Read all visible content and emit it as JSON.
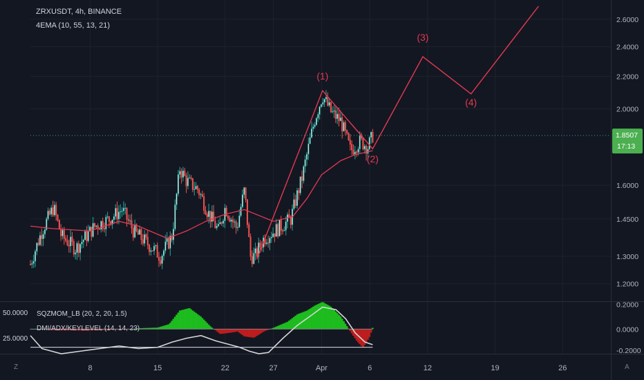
{
  "header": {
    "symbol_line": "ZRXUSDT, 4h, BINANCE",
    "indicator_line": "4EMA (10, 55, 13, 21)"
  },
  "sub_pane": {
    "indicator_1": "SQZMOM_LB (20, 2, 20, 1.5)",
    "indicator_2": "DMI/ADX/KEYLEVEL (14, 14, 23)",
    "left_scale": [
      "50.0000",
      "25.0000"
    ]
  },
  "price_badge": {
    "price": "1.8507",
    "countdown": "17:13"
  },
  "corners": {
    "left": "Z",
    "right": "A"
  },
  "colors": {
    "up": "#26a69a",
    "down": "#ef5350",
    "ema": "#e53950",
    "wave": "#e53950",
    "osc_green": "#1ec81e",
    "osc_red": "#c81e1e",
    "dmi": "#d6d6d6",
    "badge": "#4caf50"
  },
  "chart_data": [
    {
      "type": "candlestick",
      "title": "ZRXUSDT, 4h, BINANCE",
      "y_scale": "log",
      "ylim": [
        1.14,
        2.75
      ],
      "y_ticks": [
        "2.6000",
        "2.4000",
        "2.2000",
        "2.0000",
        "1.6000",
        "1.4500",
        "1.3000",
        "1.2000"
      ],
      "y_tick_values": [
        2.6,
        2.4,
        2.2,
        2.0,
        1.6,
        1.45,
        1.3,
        1.2
      ],
      "x_ticks": [
        "8",
        "15",
        "22",
        "27",
        "Apr",
        "6",
        "12",
        "19",
        "26"
      ],
      "x_tick_days": [
        8,
        15,
        22,
        27,
        32,
        37,
        43,
        50,
        57
      ],
      "x_range_days": [
        1.8,
        62.0
      ],
      "last_day": 37.3,
      "current_price": 1.8507,
      "price_path": [
        [
          1.8,
          1.27
        ],
        [
          3.0,
          1.4
        ],
        [
          4.2,
          1.5
        ],
        [
          5.0,
          1.38
        ],
        [
          6.5,
          1.33
        ],
        [
          8.5,
          1.42
        ],
        [
          10.0,
          1.45
        ],
        [
          11.3,
          1.49
        ],
        [
          12.5,
          1.4
        ],
        [
          14.5,
          1.33
        ],
        [
          15.3,
          1.3
        ],
        [
          16.5,
          1.38
        ],
        [
          17.3,
          1.68
        ],
        [
          18.0,
          1.62
        ],
        [
          19.2,
          1.58
        ],
        [
          20.2,
          1.48
        ],
        [
          21.3,
          1.4
        ],
        [
          22.0,
          1.5
        ],
        [
          23.2,
          1.41
        ],
        [
          24.0,
          1.58
        ],
        [
          24.6,
          1.3
        ],
        [
          25.1,
          1.3
        ],
        [
          26.0,
          1.37
        ],
        [
          27.5,
          1.41
        ],
        [
          28.8,
          1.45
        ],
        [
          30.0,
          1.64
        ],
        [
          31.3,
          1.94
        ],
        [
          32.1,
          2.08
        ],
        [
          33.0,
          1.98
        ],
        [
          34.0,
          1.93
        ],
        [
          35.0,
          1.77
        ],
        [
          36.0,
          1.82
        ],
        [
          36.8,
          1.79
        ],
        [
          37.3,
          1.85
        ]
      ],
      "ema_path": [
        [
          1.8,
          1.42
        ],
        [
          4.0,
          1.41
        ],
        [
          8.0,
          1.4
        ],
        [
          11.0,
          1.44
        ],
        [
          13.0,
          1.42
        ],
        [
          16.0,
          1.37
        ],
        [
          18.0,
          1.4
        ],
        [
          20.0,
          1.44
        ],
        [
          22.0,
          1.47
        ],
        [
          24.0,
          1.49
        ],
        [
          27.0,
          1.44
        ],
        [
          29.0,
          1.46
        ],
        [
          30.5,
          1.54
        ],
        [
          32.0,
          1.65
        ],
        [
          34.0,
          1.72
        ],
        [
          35.5,
          1.75
        ],
        [
          37.3,
          1.77
        ]
      ],
      "wave_path": [
        [
          25.3,
          1.29
        ],
        [
          32.1,
          2.11
        ],
        [
          37.3,
          1.78
        ],
        [
          42.5,
          2.33
        ],
        [
          47.5,
          2.09
        ],
        [
          54.5,
          2.7
        ]
      ],
      "wave_labels": [
        {
          "text": "(1)",
          "day": 32.1,
          "price": 2.18
        },
        {
          "text": "(2)",
          "day": 37.3,
          "price": 1.71
        },
        {
          "text": "(3)",
          "day": 42.5,
          "price": 2.44
        },
        {
          "text": "(4)",
          "day": 47.5,
          "price": 2.02
        }
      ]
    },
    {
      "type": "area",
      "title": "SQZMOM_LB (20, 2, 20, 1.5)",
      "right_ticks": [
        "0.2000",
        "0.0000",
        "-0.2000"
      ],
      "right_tick_values": [
        0.2,
        0.0,
        -0.2
      ],
      "ylim": [
        -0.2,
        0.22
      ],
      "momentum": [
        [
          1.8,
          0.0
        ],
        [
          3.0,
          0.0
        ],
        [
          4.5,
          -0.01
        ],
        [
          6.0,
          -0.01
        ],
        [
          7.5,
          -0.012
        ],
        [
          9.0,
          -0.008
        ],
        [
          10.5,
          -0.004
        ],
        [
          12.0,
          0.0
        ],
        [
          13.5,
          0.008
        ],
        [
          15.0,
          0.012
        ],
        [
          16.2,
          0.04
        ],
        [
          17.3,
          0.15
        ],
        [
          18.3,
          0.17
        ],
        [
          19.5,
          0.1
        ],
        [
          20.5,
          0.02
        ],
        [
          21.5,
          -0.04
        ],
        [
          22.5,
          -0.03
        ],
        [
          23.3,
          -0.02
        ],
        [
          24.0,
          -0.06
        ],
        [
          25.0,
          -0.07
        ],
        [
          26.0,
          -0.02
        ],
        [
          27.0,
          0.01
        ],
        [
          28.5,
          0.06
        ],
        [
          29.5,
          0.12
        ],
        [
          30.5,
          0.15
        ],
        [
          31.3,
          0.19
        ],
        [
          32.1,
          0.22
        ],
        [
          33.0,
          0.18
        ],
        [
          34.0,
          0.1
        ],
        [
          35.0,
          -0.02
        ],
        [
          35.7,
          -0.1
        ],
        [
          36.3,
          -0.15
        ],
        [
          37.0,
          -0.06
        ],
        [
          37.3,
          0.01
        ]
      ],
      "dmi_line": [
        [
          1.8,
          32
        ],
        [
          3.0,
          22
        ],
        [
          5.0,
          18
        ],
        [
          7.0,
          20
        ],
        [
          9.0,
          22
        ],
        [
          11.0,
          24
        ],
        [
          13.0,
          22
        ],
        [
          15.0,
          23
        ],
        [
          16.5,
          27
        ],
        [
          18.0,
          30
        ],
        [
          19.5,
          32
        ],
        [
          21.0,
          28
        ],
        [
          22.5,
          25
        ],
        [
          23.5,
          23
        ],
        [
          24.5,
          20
        ],
        [
          25.5,
          18
        ],
        [
          26.5,
          19
        ],
        [
          28.0,
          30
        ],
        [
          29.5,
          40
        ],
        [
          31.0,
          48
        ],
        [
          32.1,
          54
        ],
        [
          33.5,
          52
        ],
        [
          34.5,
          45
        ],
        [
          35.5,
          34
        ],
        [
          36.5,
          27
        ],
        [
          37.3,
          25
        ]
      ],
      "dmi_ylim": [
        18,
        58
      ],
      "keylevel": 23
    }
  ]
}
